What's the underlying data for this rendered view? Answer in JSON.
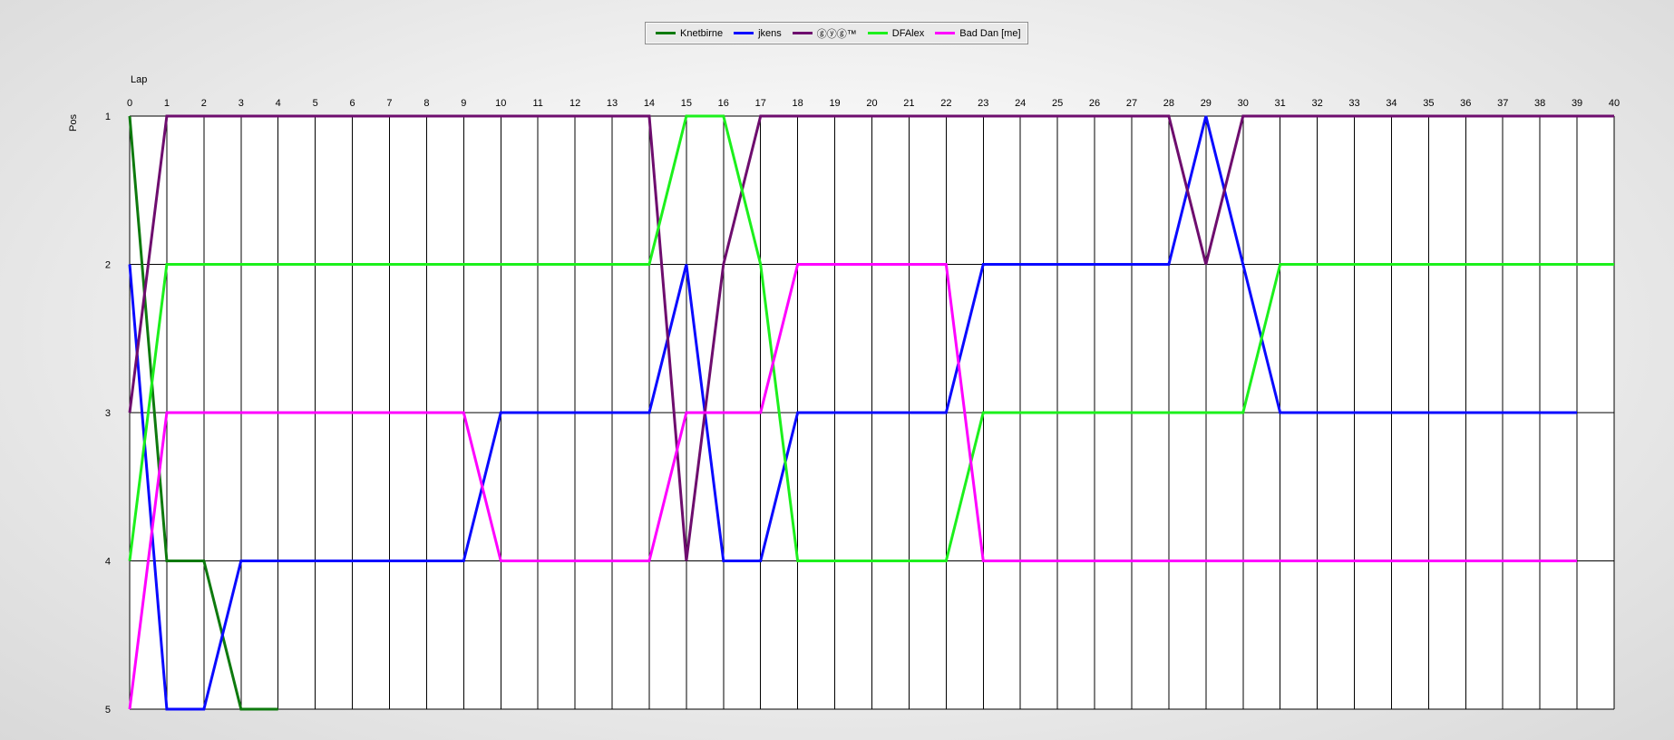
{
  "legend": {
    "items": [
      {
        "label": "Knetbirne",
        "color": "#0e7a0e"
      },
      {
        "label": "jkens",
        "color": "#0a0aff"
      },
      {
        "label": "ⓖⓨⓖ™",
        "color": "#6e0d6e"
      },
      {
        "label": "DFAlex",
        "color": "#1cf01c"
      },
      {
        "label": "Bad Dan [me]",
        "color": "#ff00ff"
      }
    ]
  },
  "chart_data": {
    "type": "line",
    "xlabel": "Lap",
    "ylabel": "Pos",
    "xlim": [
      0,
      40
    ],
    "ylim": [
      1,
      5
    ],
    "y_inverted": true,
    "x_ticks": [
      0,
      1,
      2,
      3,
      4,
      5,
      6,
      7,
      8,
      9,
      10,
      11,
      12,
      13,
      14,
      15,
      16,
      17,
      18,
      19,
      20,
      21,
      22,
      23,
      24,
      25,
      26,
      27,
      28,
      29,
      30,
      31,
      32,
      33,
      34,
      35,
      36,
      37,
      38,
      39,
      40
    ],
    "y_ticks": [
      1,
      2,
      3,
      4,
      5
    ],
    "grid": "vertical lines at every lap, horizontal lines at every position",
    "legend_position": "top-center",
    "series": [
      {
        "name": "Knetbirne",
        "color": "#0e7a0e",
        "x": [
          0,
          1,
          2,
          3,
          4
        ],
        "y": [
          1,
          4,
          4,
          5,
          5
        ]
      },
      {
        "name": "jkens",
        "color": "#0a0aff",
        "x": [
          0,
          1,
          2,
          3,
          4,
          5,
          6,
          7,
          8,
          9,
          10,
          11,
          12,
          13,
          14,
          15,
          16,
          17,
          18,
          19,
          20,
          21,
          22,
          23,
          24,
          25,
          26,
          27,
          28,
          29,
          30,
          31,
          32,
          33,
          34,
          35,
          36,
          37,
          38,
          39
        ],
        "y": [
          2,
          5,
          5,
          4,
          4,
          4,
          4,
          4,
          4,
          4,
          3,
          3,
          3,
          3,
          3,
          2,
          4,
          4,
          3,
          3,
          3,
          3,
          3,
          2,
          2,
          2,
          2,
          2,
          2,
          1,
          2,
          3,
          3,
          3,
          3,
          3,
          3,
          3,
          3,
          3
        ]
      },
      {
        "name": "ⓖⓨⓖ™",
        "color": "#6e0d6e",
        "x": [
          0,
          1,
          2,
          3,
          4,
          5,
          6,
          7,
          8,
          9,
          10,
          11,
          12,
          13,
          14,
          15,
          16,
          17,
          18,
          19,
          20,
          21,
          22,
          23,
          24,
          25,
          26,
          27,
          28,
          29,
          30,
          31,
          32,
          33,
          34,
          35,
          36,
          37,
          38,
          39,
          40
        ],
        "y": [
          3,
          1,
          1,
          1,
          1,
          1,
          1,
          1,
          1,
          1,
          1,
          1,
          1,
          1,
          1,
          4,
          2,
          1,
          1,
          1,
          1,
          1,
          1,
          1,
          1,
          1,
          1,
          1,
          1,
          2,
          1,
          1,
          1,
          1,
          1,
          1,
          1,
          1,
          1,
          1,
          1
        ]
      },
      {
        "name": "DFAlex",
        "color": "#1cf01c",
        "x": [
          0,
          1,
          2,
          3,
          4,
          5,
          6,
          7,
          8,
          9,
          10,
          11,
          12,
          13,
          14,
          15,
          16,
          17,
          18,
          19,
          20,
          21,
          22,
          23,
          24,
          25,
          26,
          27,
          28,
          29,
          30,
          31,
          32,
          33,
          34,
          35,
          36,
          37,
          38,
          39,
          40
        ],
        "y": [
          4,
          2,
          2,
          2,
          2,
          2,
          2,
          2,
          2,
          2,
          2,
          2,
          2,
          2,
          2,
          1,
          1,
          2,
          4,
          4,
          4,
          4,
          4,
          3,
          3,
          3,
          3,
          3,
          3,
          3,
          3,
          2,
          2,
          2,
          2,
          2,
          2,
          2,
          2,
          2,
          2
        ]
      },
      {
        "name": "Bad Dan [me]",
        "color": "#ff00ff",
        "x": [
          0,
          1,
          2,
          3,
          4,
          5,
          6,
          7,
          8,
          9,
          10,
          11,
          12,
          13,
          14,
          15,
          16,
          17,
          18,
          19,
          20,
          21,
          22,
          23,
          24,
          25,
          26,
          27,
          28,
          29,
          30,
          31,
          32,
          33,
          34,
          35,
          36,
          37,
          38,
          39
        ],
        "y": [
          5,
          3,
          3,
          3,
          3,
          3,
          3,
          3,
          3,
          3,
          4,
          4,
          4,
          4,
          4,
          3,
          3,
          3,
          2,
          2,
          2,
          2,
          2,
          4,
          4,
          4,
          4,
          4,
          4,
          4,
          4,
          4,
          4,
          4,
          4,
          4,
          4,
          4,
          4,
          4
        ]
      }
    ]
  }
}
